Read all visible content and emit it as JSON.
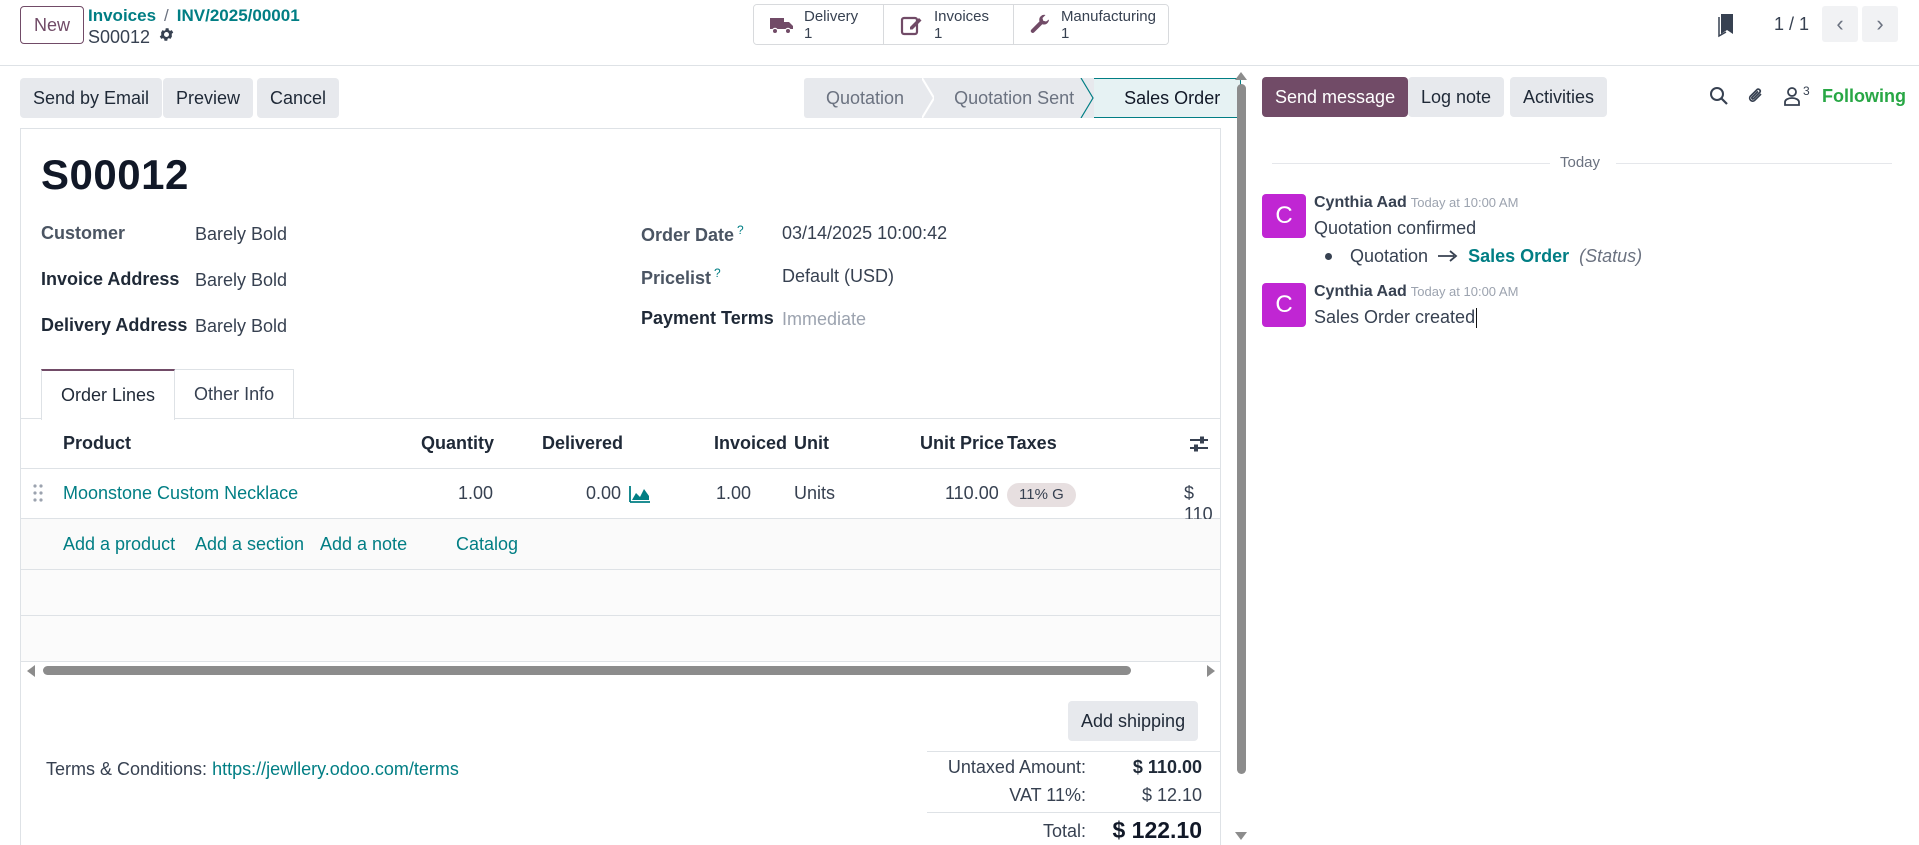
{
  "header": {
    "new_label": "New",
    "breadcrumb": [
      "Invoices",
      "INV/2025/00001"
    ],
    "record_name": "S00012",
    "smart_buttons": [
      {
        "label": "Delivery",
        "count": "1",
        "icon": "truck-icon"
      },
      {
        "label": "Invoices",
        "count": "1",
        "icon": "invoice-edit-icon"
      },
      {
        "label": "Manufacturing",
        "count": "1",
        "icon": "wrench-icon"
      }
    ],
    "pager": "1 / 1"
  },
  "actions": {
    "send_email": "Send by Email",
    "preview": "Preview",
    "cancel": "Cancel"
  },
  "statusbar": {
    "stages": [
      "Quotation",
      "Quotation Sent",
      "Sales Order"
    ],
    "active": "Sales Order"
  },
  "form": {
    "title": "S00012",
    "customer_label": "Customer",
    "customer": "Barely Bold",
    "invoice_address_label": "Invoice Address",
    "invoice_address": "Barely Bold",
    "delivery_address_label": "Delivery Address",
    "delivery_address": "Barely Bold",
    "order_date_label": "Order Date",
    "order_date": "03/14/2025 10:00:42",
    "pricelist_label": "Pricelist",
    "pricelist": "Default (USD)",
    "payment_terms_label": "Payment Terms",
    "payment_terms_placeholder": "Immediate",
    "help_mark": "?"
  },
  "tabs": [
    "Order Lines",
    "Other Info"
  ],
  "order_lines": {
    "columns": {
      "product": "Product",
      "quantity": "Quantity",
      "delivered": "Delivered",
      "invoiced": "Invoiced",
      "unit": "Unit",
      "unit_price": "Unit Price",
      "taxes": "Taxes"
    },
    "rows": [
      {
        "product": "Moonstone Custom Necklace",
        "quantity": "1.00",
        "delivered": "0.00",
        "invoiced": "1.00",
        "unit": "Units",
        "unit_price": "110.00",
        "taxes": "11% G",
        "subtotal": "$ 110"
      }
    ],
    "add_links": {
      "product": "Add a product",
      "section": "Add a section",
      "note": "Add a note",
      "catalog": "Catalog"
    }
  },
  "footer": {
    "add_shipping": "Add shipping",
    "terms_label": "Terms & Conditions:",
    "terms_link": "https://jewllery.odoo.com/terms",
    "untaxed_label": "Untaxed Amount:",
    "untaxed": "$ 110.00",
    "vat_label": "VAT 11%:",
    "vat": "$ 12.10",
    "total_label": "Total:",
    "total": "$ 122.10"
  },
  "chatter": {
    "send_message": "Send message",
    "log_note": "Log note",
    "activities": "Activities",
    "followers_count": "3",
    "following": "Following",
    "date_separator": "Today",
    "messages": [
      {
        "author": "Cynthia Aad",
        "initial": "C",
        "time": "Today at 10:00 AM",
        "body": "Quotation confirmed",
        "tracking": {
          "old": "Quotation",
          "new": "Sales Order",
          "field": "(Status)"
        }
      },
      {
        "author": "Cynthia Aad",
        "initial": "C",
        "time": "Today at 10:00 AM",
        "body": "Sales Order created"
      }
    ]
  },
  "colors": {
    "brand": "#714b67",
    "link": "#017e84",
    "following": "#28a745",
    "avatar": "#c026d3"
  }
}
